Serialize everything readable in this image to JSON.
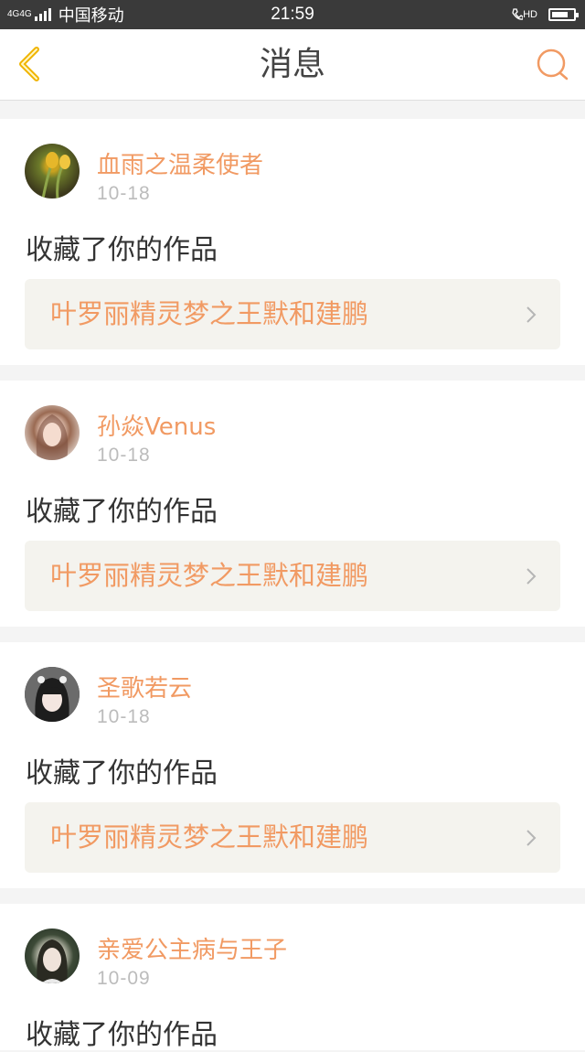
{
  "status_bar": {
    "network": "4G4G",
    "carrier": "中国移动",
    "time": "21:59",
    "hd_label": "HD",
    "battery_level": 0.75
  },
  "header": {
    "title": "消息",
    "back_icon": "chevron-left-icon",
    "search_icon": "search-icon"
  },
  "colors": {
    "accent": "#f19a63",
    "back_icon": "#f0b400",
    "card_link_bg": "#f4f3ee"
  },
  "messages": [
    {
      "username": "血雨之温柔使者",
      "date": "10-18",
      "action": "收藏了你的作品",
      "work_title": "叶罗丽精灵梦之王默和建鹏"
    },
    {
      "username": "孙焱Venus",
      "date": "10-18",
      "action": "收藏了你的作品",
      "work_title": "叶罗丽精灵梦之王默和建鹏"
    },
    {
      "username": "圣歌若云",
      "date": "10-18",
      "action": "收藏了你的作品",
      "work_title": "叶罗丽精灵梦之王默和建鹏"
    },
    {
      "username": "亲爱公主病与王子",
      "date": "10-09",
      "action": "收藏了你的作品"
    }
  ]
}
